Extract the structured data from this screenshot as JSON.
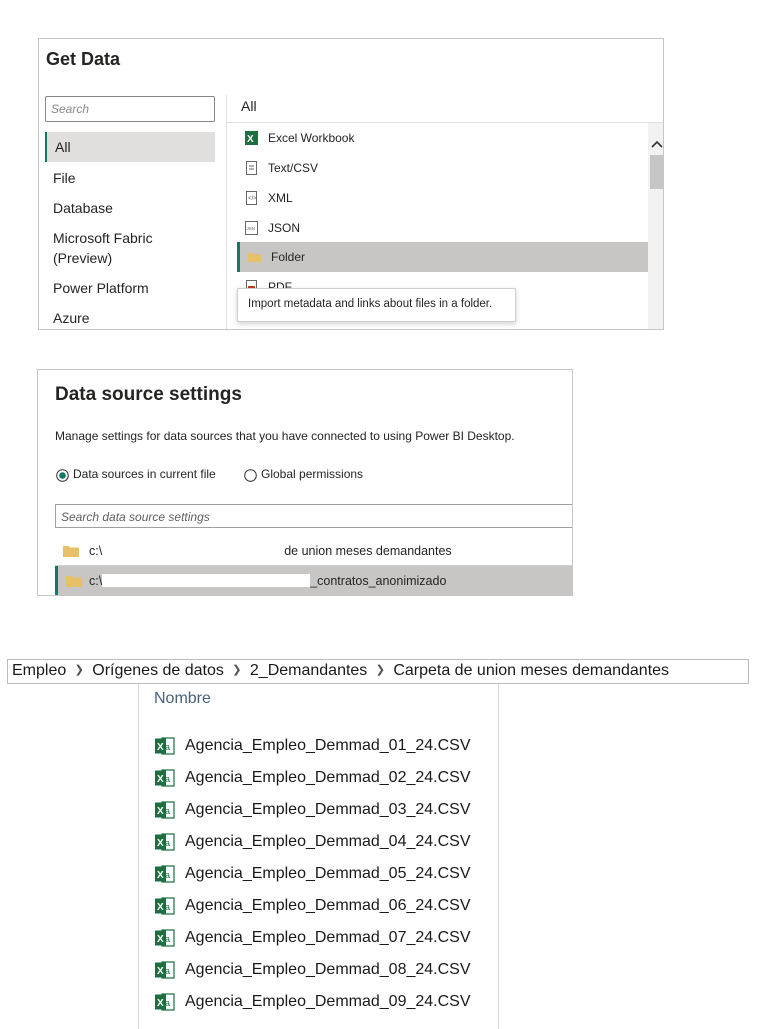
{
  "get_data": {
    "title": "Get Data",
    "search_placeholder": "Search",
    "categories": [
      "All",
      "File",
      "Database",
      "Microsoft Fabric\n(Preview)",
      "Power Platform",
      "Azure"
    ],
    "list_title": "All",
    "items": [
      {
        "label": "Excel Workbook",
        "icon": "excel-icon"
      },
      {
        "label": "Text/CSV",
        "icon": "text-file-icon"
      },
      {
        "label": "XML",
        "icon": "xml-icon"
      },
      {
        "label": "JSON",
        "icon": "json-icon"
      },
      {
        "label": "Folder",
        "icon": "folder-icon"
      },
      {
        "label": "PDF",
        "icon": "pdf-icon"
      }
    ],
    "tooltip": "Import metadata and links about files in a folder."
  },
  "data_source_settings": {
    "title": "Data source settings",
    "description": "Manage settings for data sources that you have connected to using Power BI Desktop.",
    "radio_current": "Data sources in current file",
    "radio_global": "Global permissions",
    "search_placeholder": "Search data source settings",
    "rows": [
      {
        "prefix": "c:\\",
        "suffix": "de union meses demandantes"
      },
      {
        "prefix": "c:\\",
        "suffix": "_contratos_anonimizado"
      }
    ]
  },
  "explorer": {
    "breadcrumb": [
      "Empleo",
      "Orígenes de datos",
      "2_Demandantes",
      "Carpeta de union meses demandantes"
    ],
    "column_header": "Nombre",
    "files": [
      "Agencia_Empleo_Demmad_01_24.CSV",
      "Agencia_Empleo_Demmad_02_24.CSV",
      "Agencia_Empleo_Demmad_03_24.CSV",
      "Agencia_Empleo_Demmad_04_24.CSV",
      "Agencia_Empleo_Demmad_05_24.CSV",
      "Agencia_Empleo_Demmad_06_24.CSV",
      "Agencia_Empleo_Demmad_07_24.CSV",
      "Agencia_Empleo_Demmad_08_24.CSV",
      "Agencia_Empleo_Demmad_09_24.CSV"
    ]
  },
  "colors": {
    "accent": "#117865",
    "excel_green": "#1d6f42",
    "folder_yellow": "#e8c06a"
  }
}
